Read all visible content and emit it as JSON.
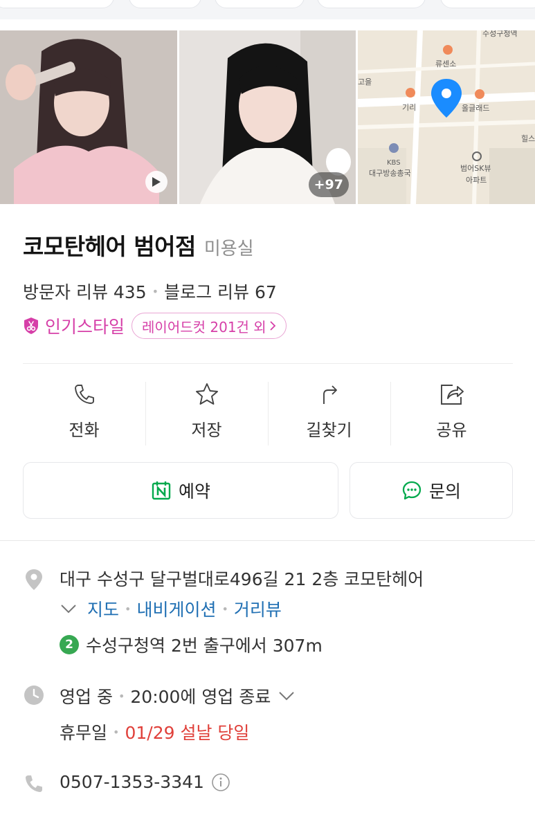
{
  "place": {
    "name": "코모탄헤어 범어점",
    "category": "미용실"
  },
  "photos": {
    "more_count": "+97"
  },
  "map": {
    "labels": [
      "수성구청역",
      "류센소",
      "고을",
      "기리",
      "올글래드",
      "힐스",
      "KBS",
      "대구방송총국",
      "범어SK뷰",
      "아파트"
    ]
  },
  "reviews": {
    "visitor": "방문자 리뷰 435",
    "blog": "블로그 리뷰 67"
  },
  "trend": {
    "label": "인기스타일",
    "chip": "레이어드컷 201건 외"
  },
  "actions": {
    "call": "전화",
    "save": "저장",
    "directions": "길찾기",
    "share": "공유"
  },
  "buttons": {
    "reserve": "예약",
    "inquiry": "문의"
  },
  "address": {
    "text": "대구 수성구 달구벌대로496길 21 2층 코모탄헤어",
    "map_link": "지도",
    "navi_link": "내비게이션",
    "street_link": "거리뷰",
    "subway_line": "2",
    "subway_text": "수성구청역 2번 출구에서 307m"
  },
  "hours": {
    "status": "영업 중",
    "close": "20:00에 영업 종료",
    "holiday_label": "휴무일",
    "holiday_value": "01/29 설날 당일"
  },
  "phone": {
    "number": "0507-1353-3341"
  },
  "colors": {
    "accent_pink": "#d63fa8",
    "link_blue": "#1f6fb3",
    "naver_green": "#03a94d",
    "subway_green": "#37a852",
    "holiday_red": "#e0403a",
    "map_pin": "#1a8cff"
  }
}
